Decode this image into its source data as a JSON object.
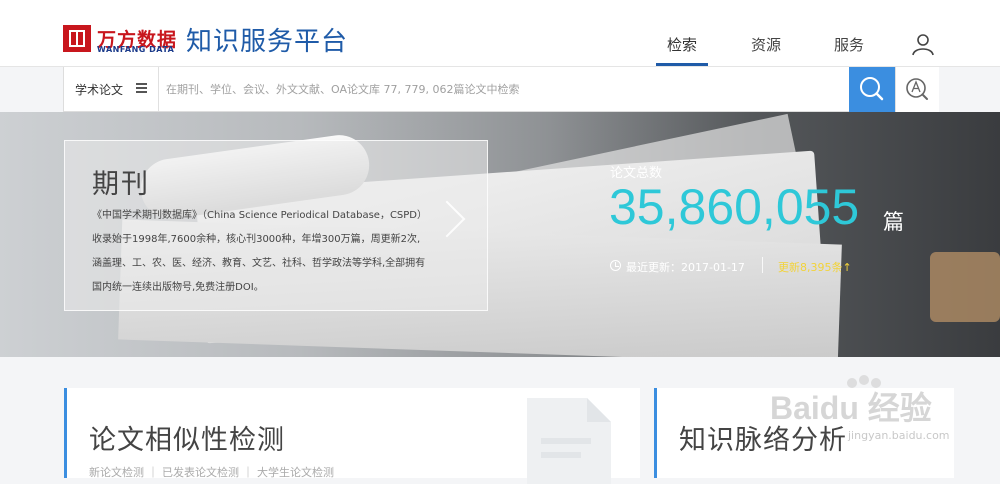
{
  "header": {
    "brand_cn": "万方数据",
    "brand_en": "WANFANG DATA",
    "platform": "知识服务平台",
    "nav": [
      {
        "label": "检索",
        "active": true
      },
      {
        "label": "资源",
        "active": false
      },
      {
        "label": "服务",
        "active": false
      }
    ],
    "icons": {
      "user": "user-icon",
      "logo": "wanfang-logo-icon"
    },
    "colors": {
      "brand_red": "#c8161d",
      "brand_blue": "#1f5ba8",
      "accent": "#3b8ee0"
    }
  },
  "search": {
    "category": "学术论文",
    "placeholder": "在期刊、学位、会议、外文文献、OA论文库 77, 779, 062篇论文中检索",
    "icons": {
      "menu": "menu-icon",
      "search": "search-icon",
      "advanced": "advanced-search-icon"
    }
  },
  "banner": {
    "card": {
      "title": "期刊",
      "description": "《中国学术期刊数据库》（China Science Periodical Database，CSPD）收录始于1998年,7600余种，核心刊3000种，年增300万篇，周更新2次,涵盖理、工、农、医、经济、教育、文艺、社科、哲学政法等学科,全部拥有国内统一连续出版物号,免费注册DOI。"
    },
    "stats": {
      "label": "论文总数",
      "value": "35,860,055",
      "unit": "篇",
      "updated": "最近更新：2017-01-17",
      "new_count": "更新8,395条↑",
      "colors": {
        "value": "#2ec8d8",
        "new": "#f2d33a"
      }
    }
  },
  "panels": [
    {
      "title": "论文相似性检测",
      "sub": "新论文检测 ｜ 已发表论文检测 ｜ 大学生论文检测"
    },
    {
      "title": "知识脉络分析"
    }
  ],
  "watermark": {
    "text": "Baidu 经验",
    "url": "jingyan.baidu.com"
  }
}
